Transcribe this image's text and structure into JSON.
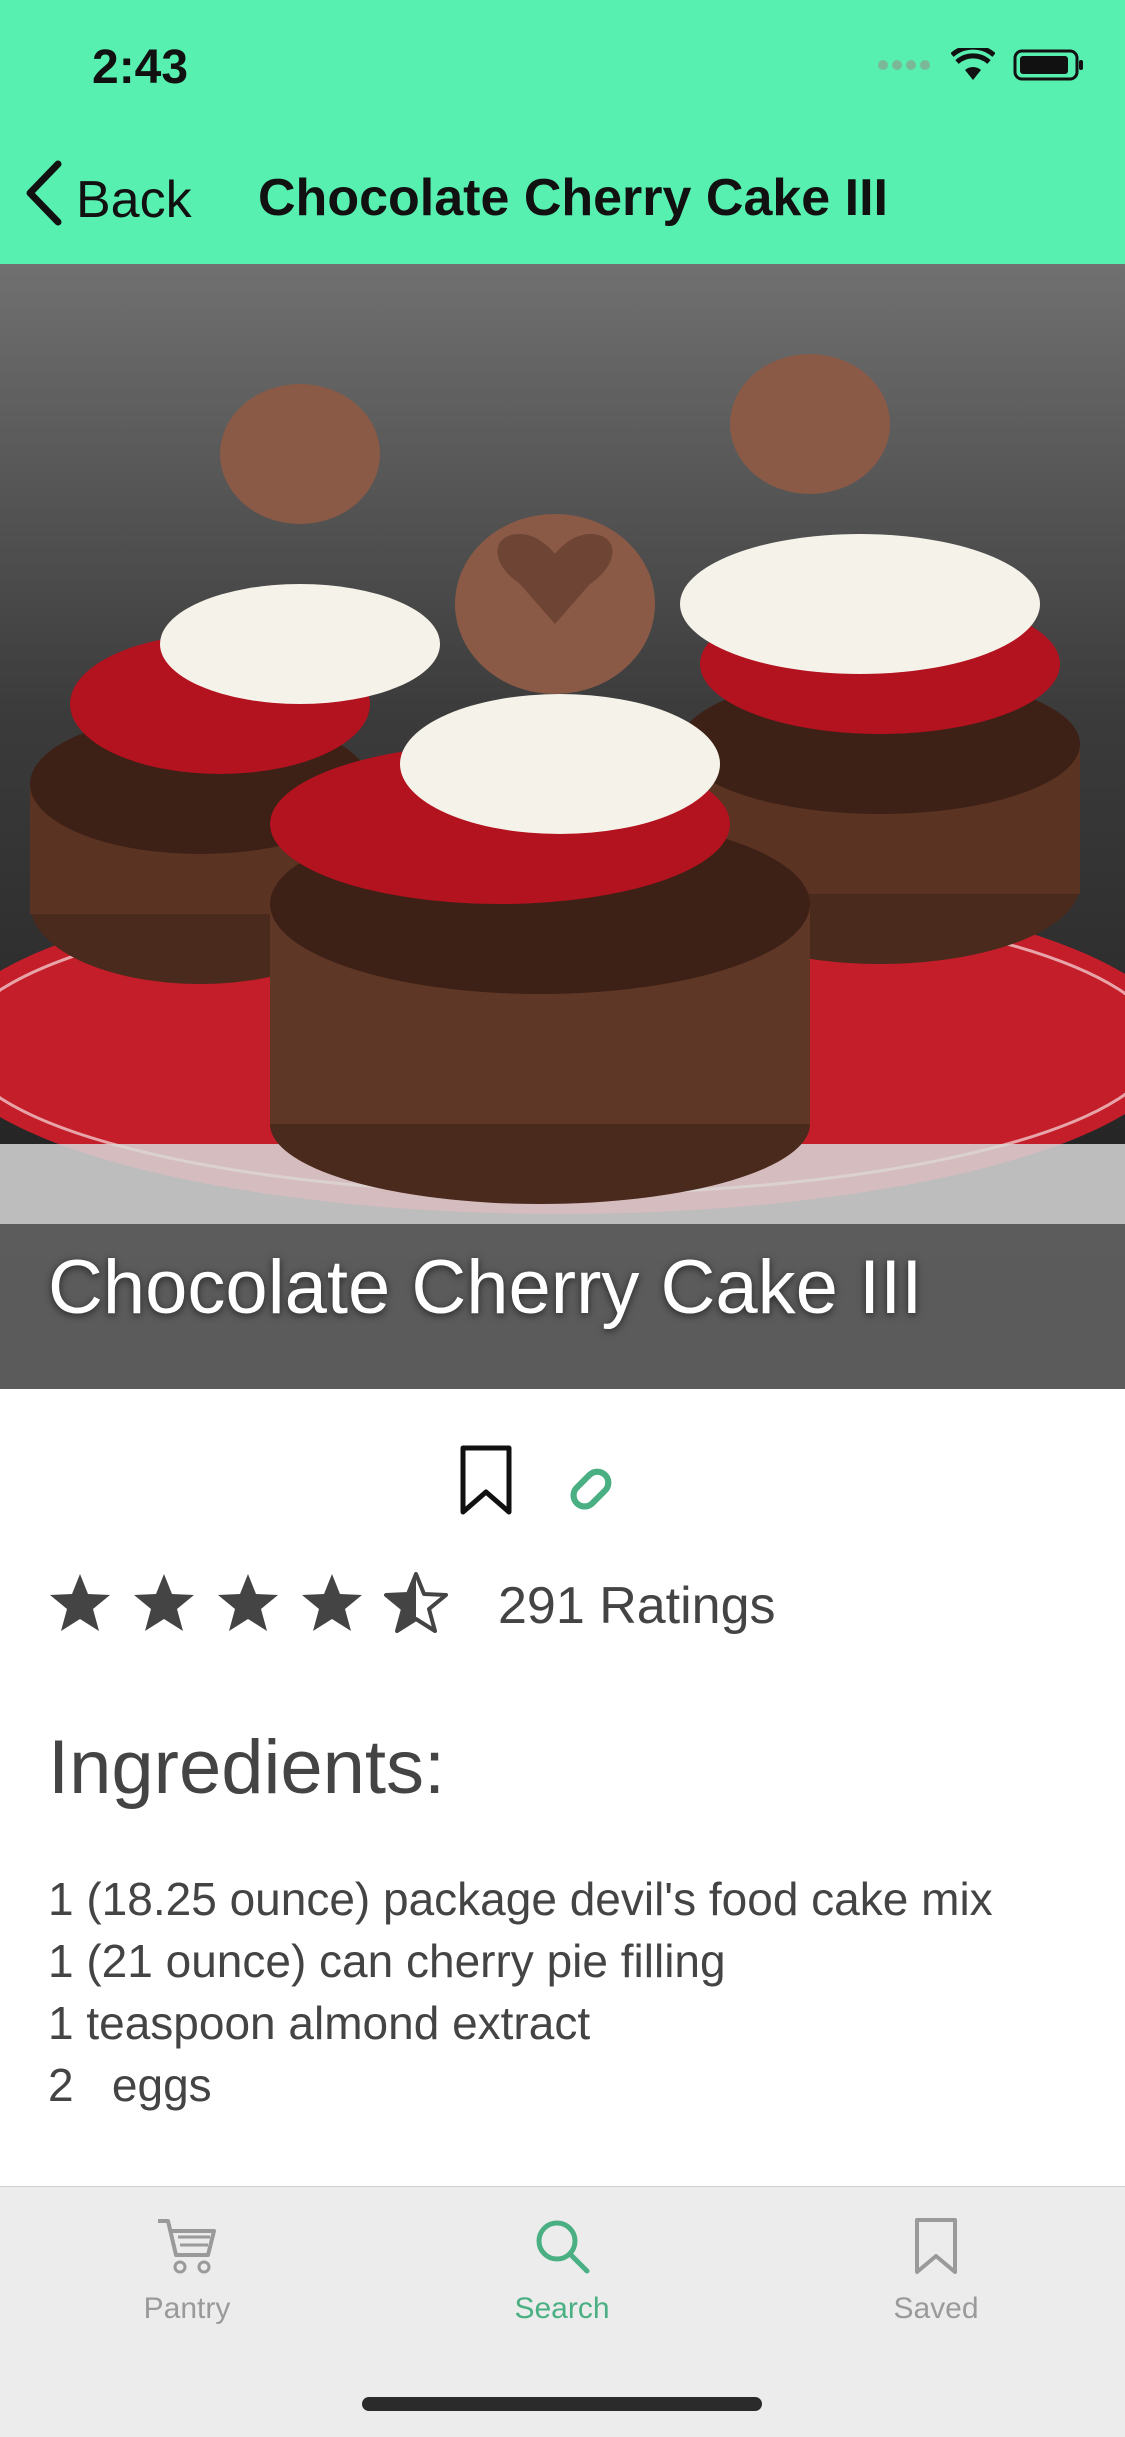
{
  "status": {
    "time": "2:43"
  },
  "nav": {
    "back_label": "Back",
    "title": "Chocolate Cherry Cake III"
  },
  "hero": {
    "title": "Chocolate Cherry Cake III"
  },
  "rating": {
    "stars": 4.5,
    "max": 5,
    "count_label": "291 Ratings"
  },
  "ingredients": {
    "heading": "Ingredients:",
    "items": [
      "1 (18.25 ounce) package devil's food cake mix",
      "1 (21 ounce) can cherry pie filling",
      "1 teaspoon almond extract",
      "2   eggs"
    ]
  },
  "tabs": [
    {
      "label": "Pantry",
      "icon": "cart-icon",
      "active": false
    },
    {
      "label": "Search",
      "icon": "search-icon",
      "active": true
    },
    {
      "label": "Saved",
      "icon": "bookmark-icon",
      "active": false
    }
  ],
  "colors": {
    "header": "#58f0b0",
    "accent": "#4ab083",
    "star": "#444444"
  }
}
